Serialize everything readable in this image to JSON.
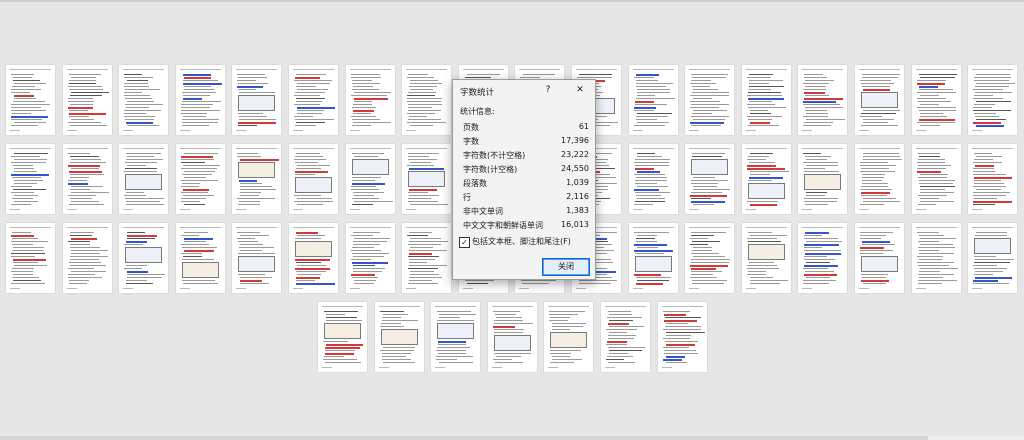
{
  "dialog": {
    "title": "字数统计",
    "help_glyph": "?",
    "close_glyph": "✕",
    "section_label": "统计信息:",
    "stats": [
      {
        "label": "页数",
        "value": "61"
      },
      {
        "label": "字数",
        "value": "17,396"
      },
      {
        "label": "字符数(不计空格)",
        "value": "23,222"
      },
      {
        "label": "字符数(计空格)",
        "value": "24,550"
      },
      {
        "label": "段落数",
        "value": "1,039"
      },
      {
        "label": "行",
        "value": "2,116"
      },
      {
        "label": "非中文单词",
        "value": "1,383"
      },
      {
        "label": "中文文字和朝鲜语单词",
        "value": "16,013"
      }
    ],
    "checkbox_label": "包括文本框、脚注和尾注(F)",
    "checkbox_checked": true,
    "checkbox_mark": "✓",
    "close_button_label": "关闭"
  },
  "pages": {
    "rows": [
      18,
      18,
      18,
      7
    ]
  }
}
